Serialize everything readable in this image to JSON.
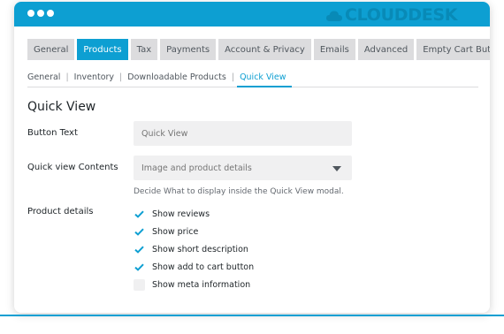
{
  "window": {
    "titlebar_color": "#0d9fd2",
    "controls": [
      "window-dot",
      "window-dot",
      "window-dot"
    ]
  },
  "watermark": {
    "text": "CLOUDDESK"
  },
  "tabs": [
    {
      "label": "General",
      "active": false
    },
    {
      "label": "Products",
      "active": true
    },
    {
      "label": "Tax",
      "active": false
    },
    {
      "label": "Payments",
      "active": false
    },
    {
      "label": "Account & Privacy",
      "active": false
    },
    {
      "label": "Emails",
      "active": false
    },
    {
      "label": "Advanced",
      "active": false
    },
    {
      "label": "Empty Cart Button",
      "active": false
    }
  ],
  "subnav": {
    "items": [
      {
        "label": "General",
        "active": false
      },
      {
        "label": "Inventory",
        "active": false
      },
      {
        "label": "Downloadable Products",
        "active": false
      },
      {
        "label": "Quick View",
        "active": true
      }
    ],
    "separator": "|"
  },
  "section": {
    "title": "Quick View"
  },
  "button_text": {
    "label": "Button Text",
    "placeholder": "Quick View"
  },
  "contents": {
    "label": "Quick view Contents",
    "selected": "Image and product details",
    "help": "Decide What to display inside the Quick View modal."
  },
  "product_details": {
    "label": "Product details",
    "options": [
      {
        "label": "Show reviews",
        "checked": true
      },
      {
        "label": "Show price",
        "checked": true
      },
      {
        "label": "Show short description",
        "checked": true
      },
      {
        "label": "Show add to cart button",
        "checked": true
      },
      {
        "label": "Show meta information",
        "checked": false
      }
    ]
  },
  "colors": {
    "accent": "#0d9fd2",
    "tab_inactive": "#dcdcde",
    "field_bg": "#f0f0f1"
  }
}
